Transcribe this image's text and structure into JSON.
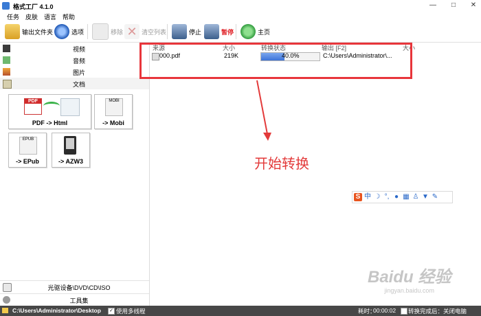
{
  "window": {
    "title": "格式工厂 4.1.0",
    "controls": [
      "—",
      "□",
      "✕"
    ]
  },
  "menu": [
    "任务",
    "皮肤",
    "语言",
    "帮助"
  ],
  "toolbar": {
    "output_folder": "输出文件夹",
    "options": "选项",
    "remove": "移除",
    "clear_list": "清空列表",
    "stop": "停止",
    "pause": "暂停",
    "home": "主页"
  },
  "sidebar": {
    "categories": [
      {
        "label": "视频",
        "icon": "video-icon"
      },
      {
        "label": "音频",
        "icon": "audio-icon"
      },
      {
        "label": "图片",
        "icon": "image-icon"
      },
      {
        "label": "文档",
        "icon": "document-icon"
      }
    ],
    "formats": [
      {
        "label": "PDF -> Html",
        "icon": "pdf-to-html-icon"
      },
      {
        "label": "-> Mobi",
        "icon": "mobi-icon"
      },
      {
        "label": "-> EPub",
        "icon": "epub-icon"
      },
      {
        "label": "-> AZW3",
        "icon": "ereader-icon"
      }
    ],
    "bottom": [
      {
        "label": "光驱设备\\DVD\\CD\\ISO",
        "icon": "disc-drive-icon"
      },
      {
        "label": "工具集",
        "icon": "tools-icon"
      }
    ]
  },
  "task_list": {
    "columns": [
      "来源",
      "大小",
      "转换状态",
      "输出 [F2]",
      "大小"
    ],
    "rows": [
      {
        "name": "000.pdf",
        "size": "219K",
        "progress_text": "40.0%",
        "progress": 0.4,
        "output": "C:\\Users\\Administrator\\..."
      }
    ]
  },
  "annotation": {
    "text": "开始转换",
    "color": "#e33a3a"
  },
  "ime_toolbar": {
    "logo": "S",
    "mode": "中"
  },
  "status": {
    "path": "C:\\Users\\Administrator\\Desktop",
    "multithread": "使用多线程",
    "elapsed_label": "耗时：",
    "elapsed": "00:00:02",
    "after_done": "转换完成后：关闭电脑"
  },
  "watermark": {
    "brand": "Baidu 经验",
    "url": "jingyan.baidu.com"
  },
  "colors": {
    "highlight": "#e8353b",
    "progress": "#3d74d8",
    "statusbar": "#474747"
  }
}
